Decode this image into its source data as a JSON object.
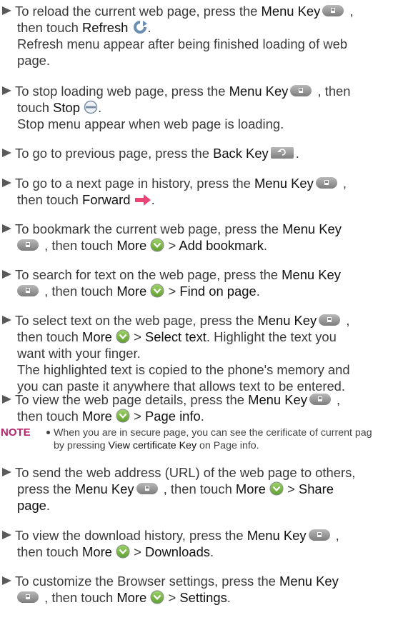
{
  "items": [
    {
      "lines": [
        "To reload the current web page, press the",
        "Menu Key",
        ",",
        "then touch",
        "Refresh",
        "."
      ],
      "extra": "Refresh menu appear after being finished loading of web page."
    },
    {
      "lines": []
    }
  ],
  "i1": {
    "a": "To reload the current web page, press the ",
    "menu_key": "Menu Key",
    "b": " ,",
    "c": "then touch ",
    "refresh": "Refresh",
    "d": ".",
    "e": "Refresh menu appear after being finished loading of web",
    "f": "page."
  },
  "i2": {
    "a": "To stop loading web page, press the ",
    "menu_key": "Menu Key",
    "b": " , then",
    "c": "touch ",
    "stop": "Stop",
    "d": ".",
    "e": "Stop menu appear when web page is loading."
  },
  "i3": {
    "a": "To go to previous page, press the ",
    "back_key": "Back Key",
    "b": "."
  },
  "i4": {
    "a": "To go to a next page in history, press the ",
    "menu_key": "Menu Key",
    "b": " ,",
    "c": "then touch ",
    "forward": "Forward",
    "d": "."
  },
  "i5": {
    "a": "To bookmark the current web page, press the ",
    "menu_key": "Menu Key",
    "b": " , then touch ",
    "more": "More",
    "c": " > ",
    "action": "Add bookmark",
    "d": "."
  },
  "i6": {
    "a": "To search for text on the web page, press the ",
    "menu_key": "Menu Key",
    "b": " , then touch ",
    "more": "More",
    "c": " > ",
    "action": "Find on page",
    "d": "."
  },
  "i7": {
    "a": "To select text on the web page, press the ",
    "menu_key": "Menu Key",
    "b": " ,",
    "c": "then touch ",
    "more": "More",
    "d": " > ",
    "action": "Select text",
    "e": ". Highlight the text you",
    "f": "want with your finger.",
    "g": "The highlighted text is copied to the phone's memory and",
    "h": "you can paste it anywhere that allows text to be entered."
  },
  "i8": {
    "a": "To view the web page details, press the ",
    "menu_key": "Menu Key",
    "b": " ,",
    "c": "then touch ",
    "more": "More",
    "d": " > ",
    "action": "Page info",
    "e": "."
  },
  "note": {
    "label": "NOTE",
    "a": "When you are in secure page, you can see the cerificate of current pag",
    "b": "by pressing ",
    "key": "View certificate Key",
    "c": " on Page info."
  },
  "i9": {
    "a": "To send the web address (URL) of the web page to others,",
    "b": "press the ",
    "menu_key": "Menu Key",
    "c": " , then touch ",
    "more": "More",
    "d": " > ",
    "action1": "Share",
    "action2": "page",
    "e": "."
  },
  "i10": {
    "a": "To view the download history, press the ",
    "menu_key": "Menu Key",
    "b": " ,",
    "c": "then touch ",
    "more": "More",
    "d": " > ",
    "action": "Downloads",
    "e": "."
  },
  "i11": {
    "a": "To customize the Browser settings, press the ",
    "menu_key": "Menu Key",
    "b": " , then touch ",
    "more": "More",
    "c": " > ",
    "action": "Settings",
    "d": "."
  },
  "icons": {
    "menu_key": "menu-key-icon",
    "back_key": "back-key-icon",
    "refresh": "refresh-icon",
    "stop": "stop-icon",
    "forward": "forward-arrow-icon",
    "more": "more-chevron-icon",
    "arrow": "triangle-bullet-icon"
  },
  "colors": {
    "note_label": "#b5256b",
    "text": "#3a3a3a",
    "icon_green": "#7ab540",
    "forward": "#ee4477"
  }
}
